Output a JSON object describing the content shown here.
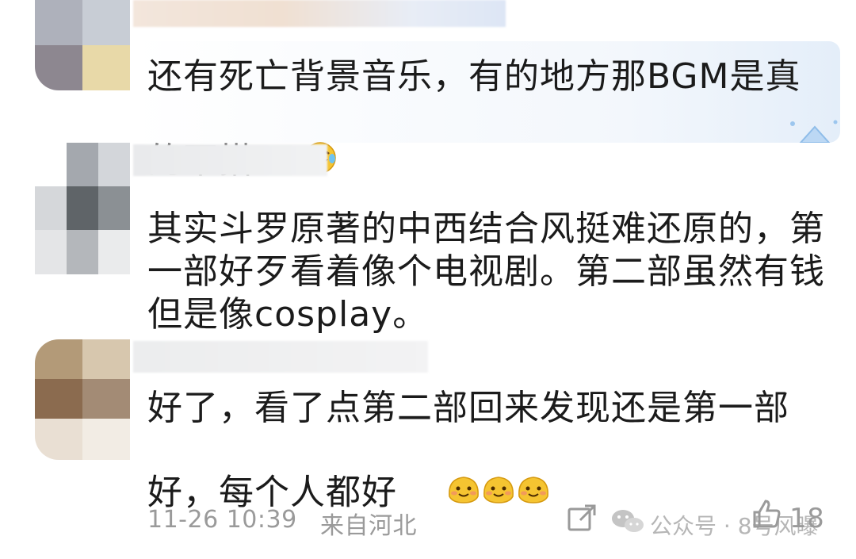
{
  "comments": [
    {
      "text": "还有死亡背景音乐，有的地方那BGM是真\n的不搭",
      "emoji": "laughing-crying-emoji"
    },
    {
      "text": "其实斗罗原著的中西结合风挺难还原的，第\n一部好歹看着像个电视剧。第二部虽然有钱\n但是像cosplay。"
    },
    {
      "text": "好了，看了点第二部回来发现还是第一部\n好，每个人都好",
      "emoji": "blushing-blob-emoji"
    }
  ],
  "footer": {
    "timestamp": "11-26 10:39",
    "location": "来自河北",
    "like_count": "18"
  },
  "watermark": {
    "text": "公众号 · 8号风曝"
  },
  "colors": {
    "text": "#1b1b1b",
    "meta": "#9a9a9a",
    "bubble_tint": "#eef4fb",
    "emoji_yellow": "#f5c431"
  }
}
